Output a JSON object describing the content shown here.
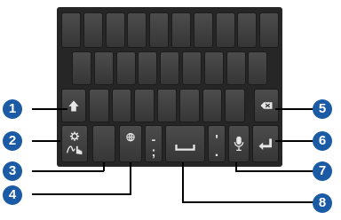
{
  "callouts": [
    "1",
    "2",
    "3",
    "4",
    "5",
    "6",
    "7",
    "8"
  ],
  "keyboard": {
    "keys": {
      "shift": "shift-icon",
      "settings": "settings-handwriting-icon",
      "language": "globe-icon",
      "punctuation": "-;",
      "space": "space-icon",
      "punctuation2": "'.",
      "voice": "microphone-icon",
      "backspace": "backspace-icon",
      "enter": "enter-icon"
    }
  },
  "colors": {
    "callout": "#1b5aa4",
    "keyboard_bg": "#262626",
    "key": "#404040"
  }
}
